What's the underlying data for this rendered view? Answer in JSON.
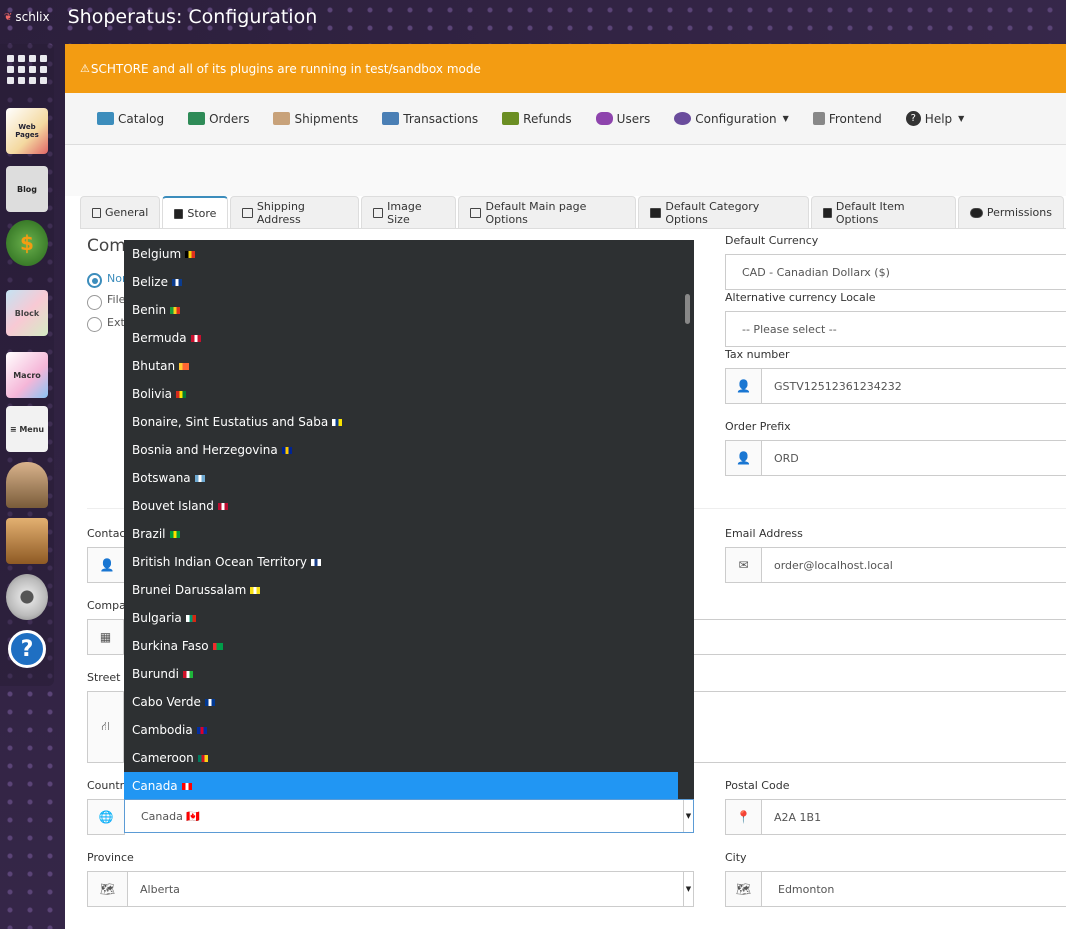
{
  "topbar": {
    "brand": "schlix",
    "title": "Shoperatus: Configuration"
  },
  "launcher": {
    "items": [
      {
        "name": "apps-grid-icon",
        "label": ""
      },
      {
        "name": "web-pages-icon",
        "label": "Web Pages"
      },
      {
        "name": "blog-icon",
        "label": "Blog"
      },
      {
        "name": "store-coin-icon",
        "label": "$"
      },
      {
        "name": "block-icon",
        "label": "Block"
      },
      {
        "name": "macro-icon",
        "label": "Macro"
      },
      {
        "name": "menu-icon",
        "label": "≡ Menu"
      },
      {
        "name": "users-icon",
        "label": ""
      },
      {
        "name": "tools-icon",
        "label": ""
      },
      {
        "name": "settings-gear-icon",
        "label": ""
      },
      {
        "name": "help-icon",
        "label": "?"
      }
    ]
  },
  "banner": "SCHTORE and all of its plugins are running in test/sandbox mode",
  "nav": [
    {
      "label": "Catalog",
      "color": "#3c8dbc"
    },
    {
      "label": "Orders",
      "color": "#2e8b57"
    },
    {
      "label": "Shipments",
      "color": "#c8a27a"
    },
    {
      "label": "Transactions",
      "color": "#4a7fb5"
    },
    {
      "label": "Refunds",
      "color": "#6b8e23"
    },
    {
      "label": "Users",
      "color": "#8e44ad"
    },
    {
      "label": "Configuration",
      "color": "#6a4c9c"
    },
    {
      "label": "Frontend",
      "color": "#888888"
    },
    {
      "label": "Help",
      "color": "#333333"
    }
  ],
  "tabs": [
    "General",
    "Store",
    "Shipping Address",
    "Image Size",
    "Default Main page Options",
    "Default Category Options",
    "Default Item Options",
    "Permissions"
  ],
  "form": {
    "section_heading": "Com",
    "radio_1": "Nor",
    "radio_2": "File",
    "radio_3": "Ext",
    "default_currency_label": "Default Currency",
    "default_currency_value": "CAD - Canadian Dollarx ($)",
    "alt_locale_label": "Alternative currency Locale",
    "alt_locale_value": "-- Please select --",
    "tax_label": "Tax number",
    "tax_value": "GSTV12512361234232",
    "order_prefix_label": "Order Prefix",
    "order_prefix_value": "ORD",
    "contact_label": "Contac",
    "email_label": "Email Address",
    "email_value": "order@localhost.local",
    "company_label": "Compa",
    "street_label": "Street A",
    "country_label": "Countr",
    "country_value": "Canada 🇨🇦",
    "postal_label": "Postal Code",
    "postal_value": "A2A 1B1",
    "province_label": "Province",
    "province_value": "Alberta",
    "city_label": "City",
    "city_value": "Edmonton"
  },
  "dropdown": {
    "options": [
      {
        "label": "Belgium",
        "flag": [
          "#000000",
          "#f5d20c",
          "#e0301e"
        ]
      },
      {
        "label": "Belize",
        "flag": [
          "#0b3c8f",
          "#ffffff",
          "#0b3c8f"
        ]
      },
      {
        "label": "Benin",
        "flag": [
          "#1a9c3e",
          "#f8d21c",
          "#e0301e"
        ]
      },
      {
        "label": "Bermuda",
        "flag": [
          "#c8102e",
          "#ffffff",
          "#c8102e"
        ]
      },
      {
        "label": "Bhutan",
        "flag": [
          "#ffcc33",
          "#ff6633",
          "#ff6633"
        ]
      },
      {
        "label": "Bolivia",
        "flag": [
          "#d52b1e",
          "#f9e300",
          "#007934"
        ]
      },
      {
        "label": "Bonaire, Sint Eustatius and Saba",
        "flag": [
          "#ffffff",
          "#0a3a8c",
          "#f9e300"
        ]
      },
      {
        "label": "Bosnia and Herzegovina",
        "flag": [
          "#002395",
          "#fecb00",
          "#002395"
        ]
      },
      {
        "label": "Botswana",
        "flag": [
          "#6da9d2",
          "#ffffff",
          "#6da9d2"
        ]
      },
      {
        "label": "Bouvet Island",
        "flag": [
          "#ba0c2f",
          "#ffffff",
          "#ba0c2f"
        ]
      },
      {
        "label": "Brazil",
        "flag": [
          "#009c3b",
          "#ffdf00",
          "#009c3b"
        ]
      },
      {
        "label": "British Indian Ocean Territory",
        "flag": [
          "#ffffff",
          "#1a3f8a",
          "#ffffff"
        ]
      },
      {
        "label": "Brunei Darussalam",
        "flag": [
          "#f7e017",
          "#ffffff",
          "#f7e017"
        ]
      },
      {
        "label": "Bulgaria",
        "flag": [
          "#ffffff",
          "#00966e",
          "#d62612"
        ]
      },
      {
        "label": "Burkina Faso",
        "flag": [
          "#ef2b2d",
          "#009e49",
          "#009e49"
        ]
      },
      {
        "label": "Burundi",
        "flag": [
          "#ce1126",
          "#ffffff",
          "#1eb53a"
        ]
      },
      {
        "label": "Cabo Verde",
        "flag": [
          "#003893",
          "#ffffff",
          "#003893"
        ]
      },
      {
        "label": "Cambodia",
        "flag": [
          "#032ea1",
          "#e00025",
          "#032ea1"
        ]
      },
      {
        "label": "Cameroon",
        "flag": [
          "#007a5e",
          "#ce1126",
          "#fcd116"
        ]
      },
      {
        "label": "Canada",
        "flag": [
          "#ff0000",
          "#ffffff",
          "#ff0000"
        ]
      }
    ],
    "selected_index": 19
  }
}
